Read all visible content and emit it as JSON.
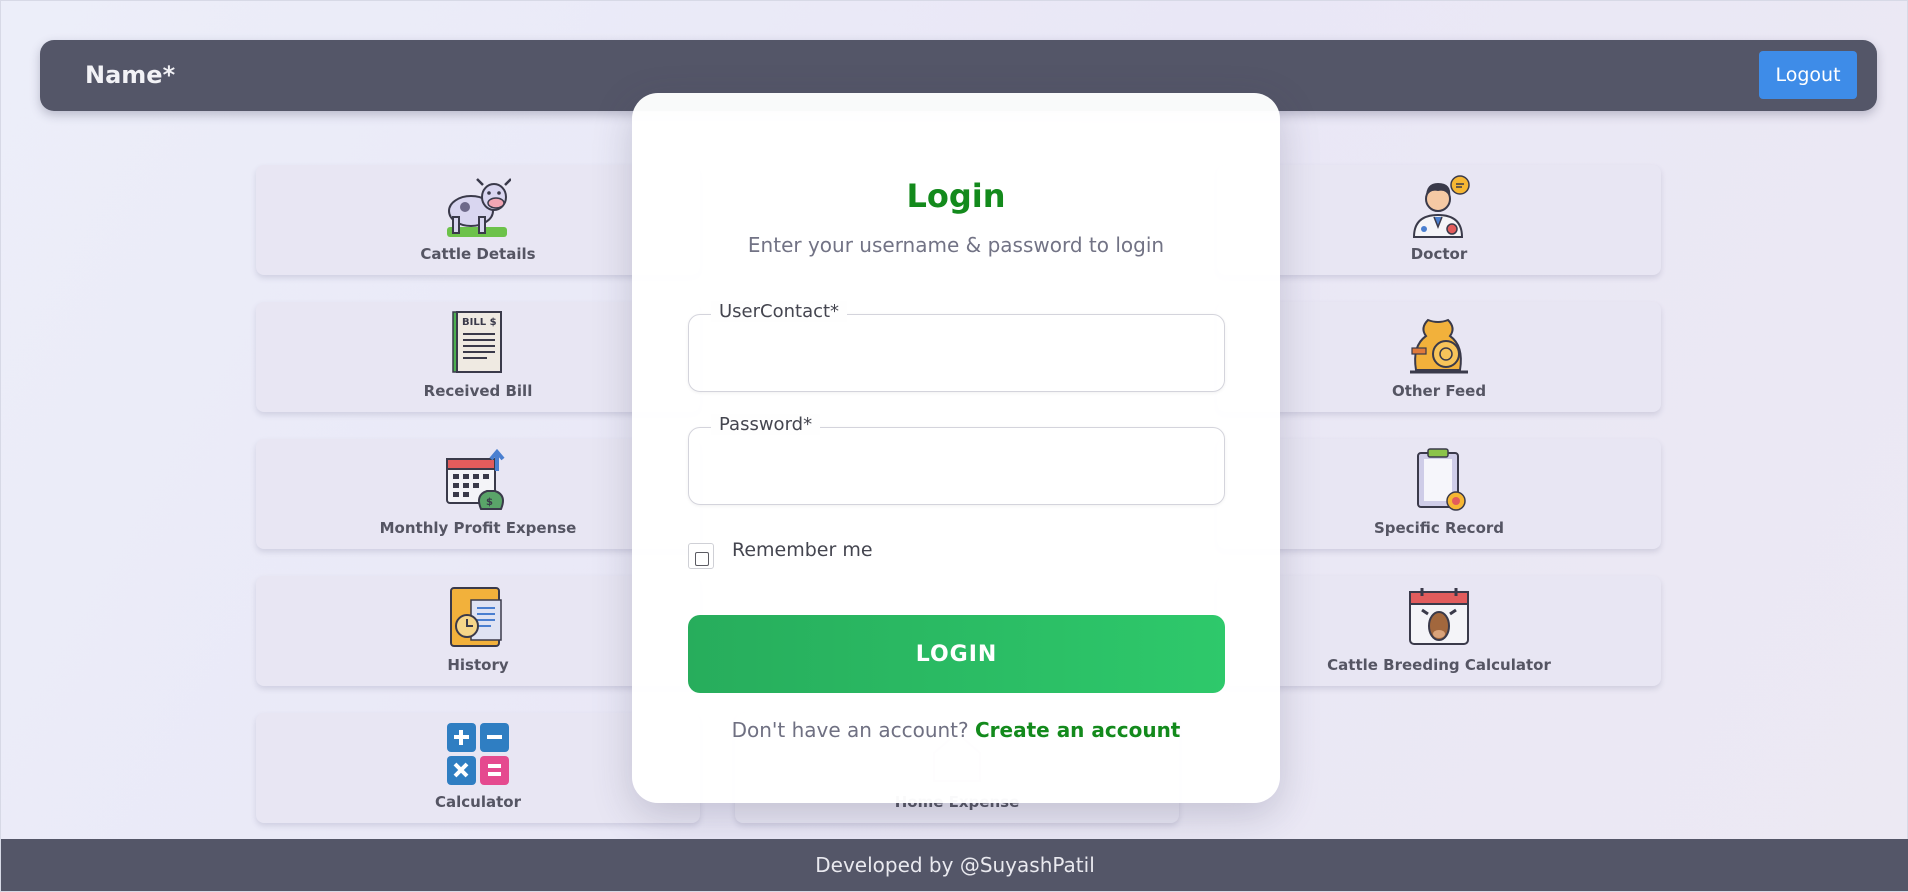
{
  "header": {
    "title": "Name*",
    "logout_label": "Logout"
  },
  "tiles": [
    {
      "label": "Cattle Details",
      "icon": "cow-icon"
    },
    {
      "label": "Doctor",
      "icon": "doctor-icon"
    },
    {
      "label": "Received Bill",
      "icon": "bill-icon"
    },
    {
      "label": "Other Feed",
      "icon": "feed-sack-icon"
    },
    {
      "label": "Monthly Profit Expense",
      "icon": "calendar-money-icon"
    },
    {
      "label": "Specific Record",
      "icon": "clipboard-icon"
    },
    {
      "label": "History",
      "icon": "history-folder-icon"
    },
    {
      "label": "Cattle Breeding Calculator",
      "icon": "breeding-calendar-icon"
    },
    {
      "label": "Calculator",
      "icon": "calculator-icon"
    },
    {
      "label": "Home Expense",
      "icon": "home-expense-icon"
    }
  ],
  "login": {
    "title": "Login",
    "subtitle": "Enter your username & password to login",
    "user_label": "UserContact*",
    "user_value": "",
    "password_label": "Password*",
    "password_value": "",
    "remember_label": "Remember me",
    "remember_checked": false,
    "button_label": "LOGIN",
    "signup_prompt": "Don't have an account?",
    "signup_link": "Create an account"
  },
  "footer": {
    "text": "Developed by @SuyashPatil"
  },
  "colors": {
    "accent_green": "#138a1c",
    "button_green": "#2ec96b",
    "header_bg": "#545668",
    "logout_blue": "#3e8ce8"
  }
}
